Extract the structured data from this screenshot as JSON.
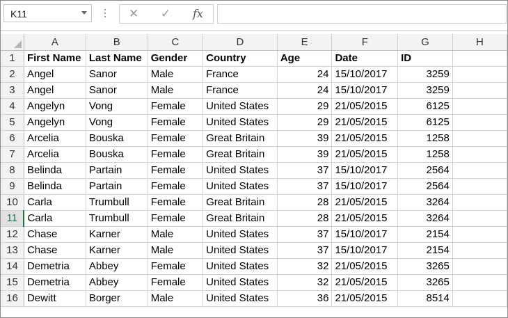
{
  "formula_bar": {
    "name_box": "K11",
    "cancel_icon": "✕",
    "enter_icon": "✓",
    "function_icon": "fx",
    "formula_value": ""
  },
  "sheet": {
    "columns": [
      "A",
      "B",
      "C",
      "D",
      "E",
      "F",
      "G",
      "H"
    ],
    "active_row": 11,
    "rows": [
      {
        "n": "1",
        "cells": [
          "First Name",
          "Last Name",
          "Gender",
          "Country",
          "Age",
          "Date",
          "ID",
          ""
        ]
      },
      {
        "n": "2",
        "cells": [
          "Angel",
          "Sanor",
          "Male",
          "France",
          "24",
          "15/10/2017",
          "3259",
          ""
        ]
      },
      {
        "n": "3",
        "cells": [
          "Angel",
          "Sanor",
          "Male",
          "France",
          "24",
          "15/10/2017",
          "3259",
          ""
        ]
      },
      {
        "n": "4",
        "cells": [
          "Angelyn",
          "Vong",
          "Female",
          "United States",
          "29",
          "21/05/2015",
          "6125",
          ""
        ]
      },
      {
        "n": "5",
        "cells": [
          "Angelyn",
          "Vong",
          "Female",
          "United States",
          "29",
          "21/05/2015",
          "6125",
          ""
        ]
      },
      {
        "n": "6",
        "cells": [
          "Arcelia",
          "Bouska",
          "Female",
          "Great Britain",
          "39",
          "21/05/2015",
          "1258",
          ""
        ]
      },
      {
        "n": "7",
        "cells": [
          "Arcelia",
          "Bouska",
          "Female",
          "Great Britain",
          "39",
          "21/05/2015",
          "1258",
          ""
        ]
      },
      {
        "n": "8",
        "cells": [
          "Belinda",
          "Partain",
          "Female",
          "United States",
          "37",
          "15/10/2017",
          "2564",
          ""
        ]
      },
      {
        "n": "9",
        "cells": [
          "Belinda",
          "Partain",
          "Female",
          "United States",
          "37",
          "15/10/2017",
          "2564",
          ""
        ]
      },
      {
        "n": "10",
        "cells": [
          "Carla",
          "Trumbull",
          "Female",
          "Great Britain",
          "28",
          "21/05/2015",
          "3264",
          ""
        ]
      },
      {
        "n": "11",
        "cells": [
          "Carla",
          "Trumbull",
          "Female",
          "Great Britain",
          "28",
          "21/05/2015",
          "3264",
          ""
        ]
      },
      {
        "n": "12",
        "cells": [
          "Chase",
          "Karner",
          "Male",
          "United States",
          "37",
          "15/10/2017",
          "2154",
          ""
        ]
      },
      {
        "n": "13",
        "cells": [
          "Chase",
          "Karner",
          "Male",
          "United States",
          "37",
          "15/10/2017",
          "2154",
          ""
        ]
      },
      {
        "n": "14",
        "cells": [
          "Demetria",
          "Abbey",
          "Female",
          "United States",
          "32",
          "21/05/2015",
          "3265",
          ""
        ]
      },
      {
        "n": "15",
        "cells": [
          "Demetria",
          "Abbey",
          "Female",
          "United States",
          "32",
          "21/05/2015",
          "3265",
          ""
        ]
      },
      {
        "n": "16",
        "cells": [
          "Dewitt",
          "Borger",
          "Male",
          "United States",
          "36",
          "21/05/2015",
          "8514",
          ""
        ]
      }
    ]
  },
  "colors": {
    "accent": "#217346",
    "header_bg": "#f3f3f3",
    "gridline": "#d4d4d4"
  }
}
